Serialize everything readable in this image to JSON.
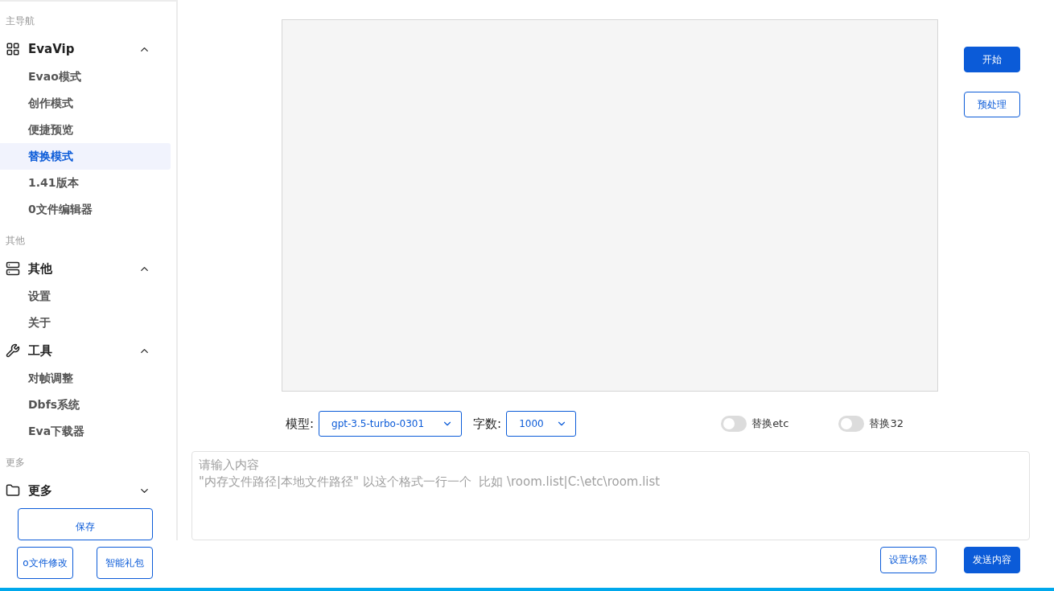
{
  "sidebar": {
    "sections": [
      {
        "header": "主导航",
        "groups": [
          {
            "label": "EvaVip",
            "expanded": true,
            "items": [
              {
                "label": "Evao模式",
                "selected": false
              },
              {
                "label": "创作模式",
                "selected": false
              },
              {
                "label": "便捷预览",
                "selected": false
              },
              {
                "label": "替换模式",
                "selected": true
              },
              {
                "label": "1.41版本",
                "selected": false
              },
              {
                "label": "0文件编辑器",
                "selected": false
              }
            ]
          }
        ]
      },
      {
        "header": "其他",
        "groups": [
          {
            "label": "其他",
            "expanded": true,
            "items": [
              {
                "label": "设置",
                "selected": false
              },
              {
                "label": "关于",
                "selected": false
              }
            ]
          },
          {
            "label": "工具",
            "expanded": true,
            "items": [
              {
                "label": "对帧调整",
                "selected": false
              },
              {
                "label": "Dbfs系统",
                "selected": false
              },
              {
                "label": "Eva下载器",
                "selected": false
              }
            ]
          }
        ]
      },
      {
        "header": "更多",
        "groups": [
          {
            "label": "更多",
            "expanded": false
          }
        ]
      }
    ]
  },
  "save_button": "保存",
  "sidebar_buttons": [
    "o文件修改",
    "智能礼包"
  ],
  "side_buttons": [
    {
      "label": "开始",
      "primary": true
    },
    {
      "label": "预处理",
      "primary": false
    }
  ],
  "controls": {
    "model_label": "模型:",
    "model_value": "gpt-3.5-turbo-0301",
    "count_label": "字数:",
    "count_value": "1000",
    "switches": [
      {
        "label": "替换etc",
        "on": false
      },
      {
        "label": "替换32",
        "on": false
      }
    ]
  },
  "input": {
    "placeholder": "请输入内容\n\"内存文件路径|本地文件路径\" 以这个格式一行一个  比如 \\room.list|C:\\etc\\room.list"
  },
  "bottom_buttons": [
    {
      "label": "设置场景",
      "primary": false
    },
    {
      "label": "发送内容",
      "primary": true
    }
  ]
}
